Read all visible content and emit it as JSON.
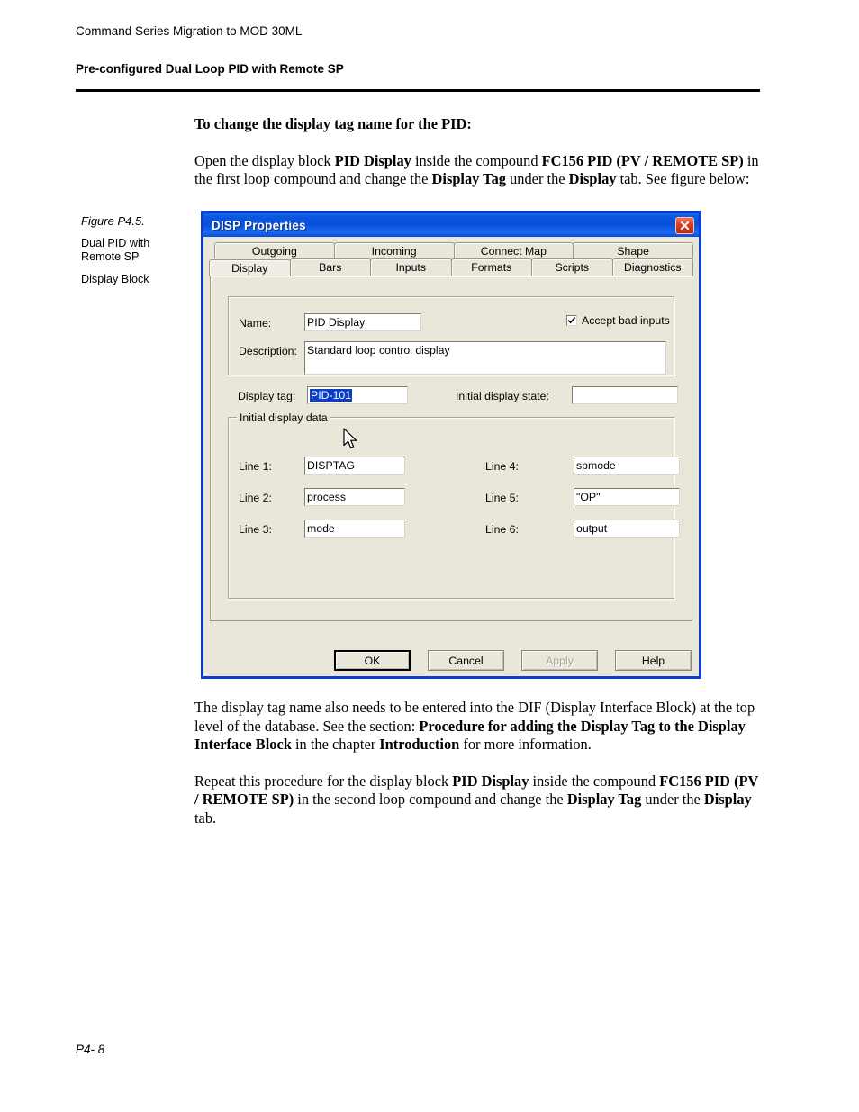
{
  "page": {
    "running_head": "Command Series Migration to MOD 30ML",
    "section_title": "Pre-configured Dual Loop PID with Remote SP",
    "footer": "P4- 8"
  },
  "figure_caption": {
    "number": "Figure P4.5.",
    "line2": "Dual PID with Remote SP",
    "line3": "Display Block"
  },
  "body": {
    "lead": "To change the display tag name for the PID:",
    "para1": {
      "seg1": "Open the display block ",
      "b1": "PID Display",
      "seg2": " inside the compound ",
      "b2": "FC156 PID (PV / REMOTE SP)",
      "seg3": " in the first loop compound and change the ",
      "b3": "Display Tag",
      "seg4": " under the ",
      "b4": "Display",
      "seg5": " tab. See figure below:"
    },
    "para2": {
      "seg1": "The display tag name also needs to be entered into the DIF (Display Interface Block) at the top level of the database. See the section: ",
      "b1": "Procedure for adding the Display Tag to the Display Interface Block",
      "seg2": " in the chapter ",
      "b2": "Introduction",
      "seg3": " for more information."
    },
    "para3": {
      "seg1": "Repeat this procedure for the display block ",
      "b1": "PID Display",
      "seg2": " inside the compound ",
      "b2": "FC156 PID (PV / REMOTE SP)",
      "seg3": " in the second loop compound and change the ",
      "b3": "Display Tag",
      "seg4": " under the ",
      "b4": "Display",
      "seg5": " tab."
    }
  },
  "dialog": {
    "title": "DISP Properties",
    "close_icon": "close-icon",
    "colors": {
      "titlebar": "#0a4fdd",
      "border": "#0a3fd4",
      "face": "#e9e6da",
      "selection": "#0a40c8",
      "close_button": "#d9401f"
    },
    "tabs_row1": [
      {
        "label": "Outgoing",
        "selected": false
      },
      {
        "label": "Incoming",
        "selected": false
      },
      {
        "label": "Connect Map",
        "selected": false
      },
      {
        "label": "Shape",
        "selected": false
      }
    ],
    "tabs_row2": [
      {
        "label": "Display",
        "selected": true
      },
      {
        "label": "Bars",
        "selected": false
      },
      {
        "label": "Inputs",
        "selected": false
      },
      {
        "label": "Formats",
        "selected": false
      },
      {
        "label": "Scripts",
        "selected": false
      },
      {
        "label": "Diagnostics",
        "selected": false
      }
    ],
    "display_tab": {
      "name_label": "Name:",
      "name_value": "PID Display",
      "accept_bad_inputs_label": "Accept bad inputs",
      "accept_bad_inputs_checked": true,
      "description_label": "Description:",
      "description_value": "Standard loop control display",
      "display_tag_label": "Display tag:",
      "display_tag_value": "PID-101",
      "display_tag_selected": true,
      "initial_display_state_label": "Initial display state:",
      "initial_display_state_value": "",
      "initial_display_data_group": "Initial display data",
      "lines": [
        {
          "label": "Line 1:",
          "value": "DISPTAG"
        },
        {
          "label": "Line 2:",
          "value": "process"
        },
        {
          "label": "Line 3:",
          "value": "mode"
        },
        {
          "label": "Line 4:",
          "value": "spmode"
        },
        {
          "label": "Line 5:",
          "value": "\"OP\""
        },
        {
          "label": "Line 6:",
          "value": "output"
        }
      ]
    },
    "buttons": [
      {
        "label": "OK",
        "state": "default"
      },
      {
        "label": "Cancel",
        "state": "normal"
      },
      {
        "label": "Apply",
        "state": "disabled"
      },
      {
        "label": "Help",
        "state": "normal"
      }
    ]
  }
}
